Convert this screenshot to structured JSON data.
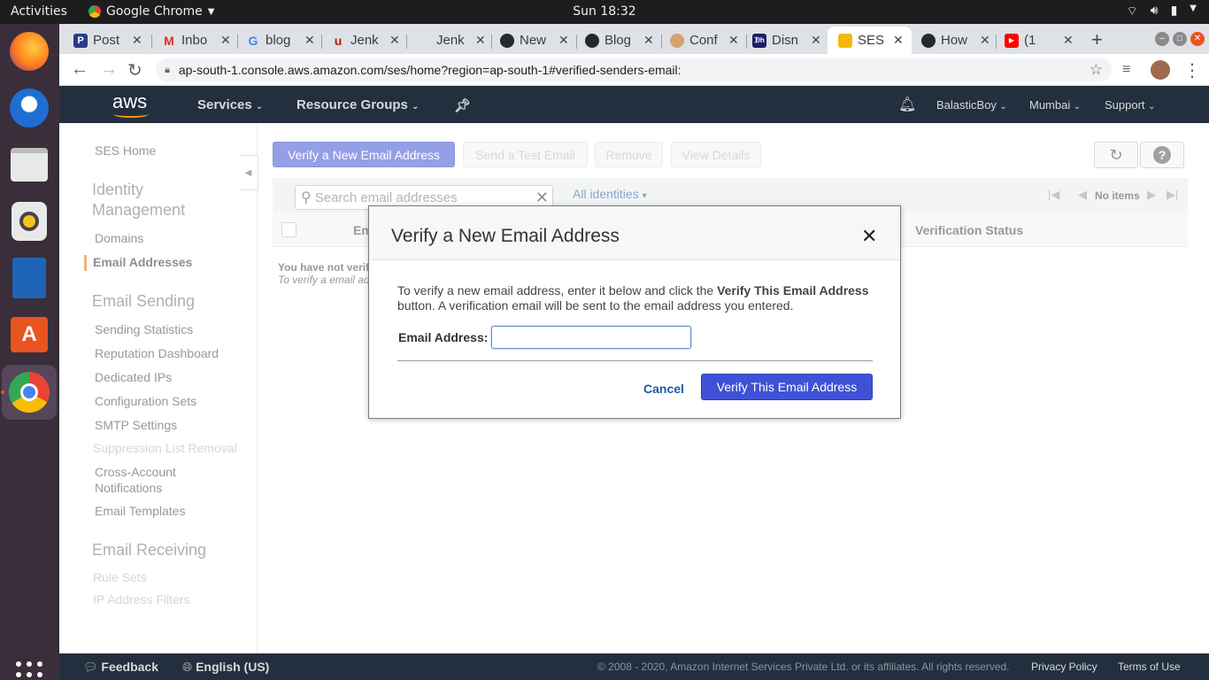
{
  "topbar": {
    "activities": "Activities",
    "app_name": "Google Chrome",
    "clock": "Sun 18:32"
  },
  "chrome": {
    "tabs": [
      {
        "label": "Post",
        "icon": "postman-icon",
        "color": "#2b3b8c"
      },
      {
        "label": "Inbo",
        "icon": "gmail-icon",
        "color": "#d93025"
      },
      {
        "label": "blog",
        "icon": "google-icon",
        "color": "#4285f4"
      },
      {
        "label": "Jenk",
        "icon": "udemy-icon",
        "color": "#a82400"
      },
      {
        "label": "Jenk",
        "icon": "blank-icon",
        "color": "#dee1e6"
      },
      {
        "label": "New",
        "icon": "github-icon",
        "color": "#24292e"
      },
      {
        "label": "Blog",
        "icon": "github-icon",
        "color": "#24292e"
      },
      {
        "label": "Conf",
        "icon": "jenkins-icon",
        "color": "#d4a373"
      },
      {
        "label": "Disn",
        "icon": "disney-icon",
        "color": "#1a1d6b"
      },
      {
        "label": "SES",
        "icon": "aws-ses-icon",
        "color": "#f2b90c"
      },
      {
        "label": "How",
        "icon": "github-icon",
        "color": "#24292e"
      },
      {
        "label": "(1",
        "icon": "youtube-icon",
        "color": "#ff0000"
      }
    ],
    "url": "ap-south-1.console.aws.amazon.com/ses/home?region=ap-south-1#verified-senders-email:"
  },
  "aws_nav": {
    "logo": "aws",
    "services": "Services",
    "resource_groups": "Resource Groups",
    "account": "BalasticBoy",
    "region": "Mumbai",
    "support": "Support"
  },
  "sidebar": {
    "ses_home": "SES Home",
    "identity_heading": "Identity Management",
    "domains": "Domains",
    "email_addresses": "Email Addresses",
    "sending_heading": "Email Sending",
    "sending_items": [
      "Sending Statistics",
      "Reputation Dashboard",
      "Dedicated IPs",
      "Configuration Sets",
      "SMTP Settings"
    ],
    "suppression": "Suppression List Removal",
    "cross_account": "Cross-Account Notifications",
    "templates": "Email Templates",
    "receiving_heading": "Email Receiving",
    "rule_sets": "Rule Sets",
    "ip_filters": "IP Address Filters"
  },
  "toolbar": {
    "verify_new": "Verify a New Email Address",
    "send_test": "Send a Test Email",
    "remove": "Remove",
    "view_details": "View Details"
  },
  "filter": {
    "search_placeholder": "Search email addresses",
    "identities": "All identities",
    "paging": "No items"
  },
  "table": {
    "col_email": "Em",
    "col_status": "Verification Status",
    "empty_line1": "You have not verif",
    "empty_line2": "To verify a email ad"
  },
  "modal": {
    "title": "Verify a New Email Address",
    "body_pre": "To verify a new email address, enter it below and click the ",
    "body_bold": "Verify This Email Address",
    "body_post": " button. A verification email will be sent to the email address you entered.",
    "email_label": "Email Address:",
    "email_value": "",
    "cancel": "Cancel",
    "verify": "Verify This Email Address"
  },
  "footer": {
    "feedback": "Feedback",
    "language": "English (US)",
    "copyright": "© 2008 - 2020, Amazon Internet Services Private Ltd. or its affiliates. All rights reserved.",
    "privacy": "Privacy Policy",
    "terms": "Terms of Use"
  }
}
